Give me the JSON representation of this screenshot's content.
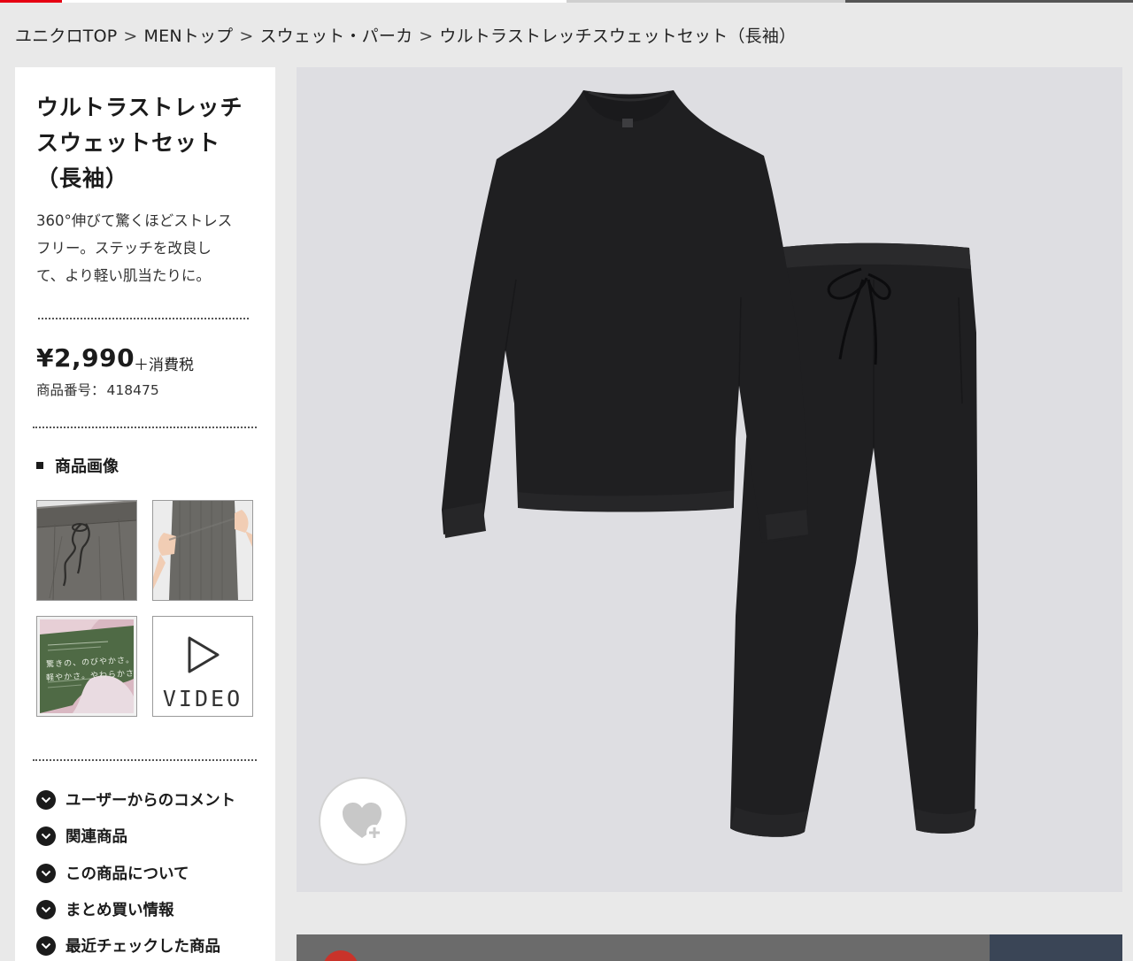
{
  "breadcrumb": {
    "items": [
      "ユニクロTOP",
      "MENトップ",
      "スウェット・パーカ",
      "ウルトラストレッチスウェットセット（長袖）"
    ],
    "separator": ">"
  },
  "product": {
    "title_lines": [
      "ウルトラストレッチ",
      "スウェットセット",
      "（長袖）"
    ],
    "description_lines": [
      "360°伸びて驚くほどストレス",
      "フリー。ステッチを改良し",
      "て、より軽い肌当たりに。"
    ],
    "price": "¥2,990",
    "tax_label": "＋消費税",
    "code_label": "商品番号：",
    "code_value": "418475"
  },
  "images_section": {
    "heading": "商品画像",
    "thumbnails": [
      {
        "name": "waistband-closeup"
      },
      {
        "name": "stretch-demo"
      },
      {
        "name": "promo-card",
        "texts": [
          "驚きの、のびやかさ。",
          "軽やかさ。やわらかさ。"
        ]
      },
      {
        "name": "video",
        "label": "VIDEO"
      }
    ]
  },
  "accordion": [
    {
      "label": "ユーザーからのコメント"
    },
    {
      "label": "関連商品"
    },
    {
      "label": "この商品について"
    },
    {
      "label": "まとめ買い情報"
    },
    {
      "label": "最近チェックした商品"
    }
  ],
  "main_image": {
    "favorite_icon": "heart-plus-icon"
  },
  "colors": {
    "accent": "#e60012",
    "garment": "#1d1d1f",
    "background": "#dedee2"
  }
}
